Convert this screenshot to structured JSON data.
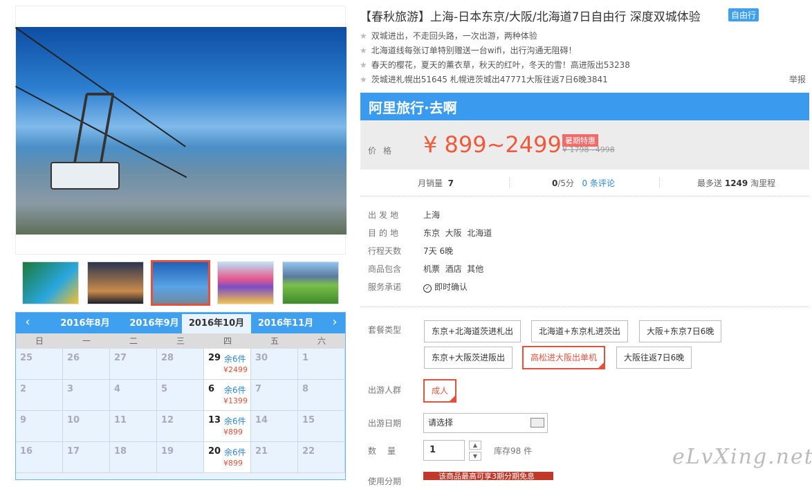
{
  "product": {
    "brand_tag": "【春秋旅游】",
    "title": "上海-日本东京/大阪/北海道7日自由行 深度双城体验",
    "self_tag": "自由行",
    "features": [
      "双城进出，不走回头路，一次出游，两种体验",
      "北海道线每张订单特别赠送一台wifi，出行沟通无阻碍！",
      "春天的樱花，夏天的薰衣草，秋天的红叶，冬天的雪！高进阪出53238",
      "茨城进札幌出51645 札幌进茨城出47771大阪往返7日6晚3841"
    ],
    "report_label": "举报"
  },
  "banner": {
    "logo": "阿里旅行·去啊"
  },
  "price": {
    "label": "价格",
    "value": "¥ 899~2499",
    "promo": "暑期特惠",
    "original": "¥ 1798~4998"
  },
  "stats": {
    "monthly_sales_label": "月销量",
    "monthly_sales": "7",
    "score": "0",
    "score_suffix": "/5分",
    "reviews": "0 条评论",
    "points_prefix": "最多送",
    "points": "1249",
    "points_suffix": "淘里程"
  },
  "info": [
    {
      "label": "出发地",
      "value": "上海"
    },
    {
      "label": "目的地",
      "value": "东京  大阪  北海道"
    },
    {
      "label": "行程天数",
      "value": "7天 6晚"
    },
    {
      "label": "商品包含",
      "value": "机票  酒店  其他"
    },
    {
      "label": "服务承诺",
      "value": "即时确认"
    }
  ],
  "options": {
    "package_label": "套餐类型",
    "packages": [
      "东京+北海道茨进札出",
      "北海道+东京札进茨出",
      "大阪+东京7日6晚",
      "东京+大阪茨进阪出",
      "高松进大阪出单机",
      "大阪往返7日6晚"
    ],
    "selected_package": "高松进大阪出单机",
    "crowd_label": "出游人群",
    "crowd": "成人",
    "date_label": "出游日期",
    "date_placeholder": "请选择",
    "qty_label": "数量",
    "qty": "1",
    "stock": "库存98 件",
    "installment_label": "使用分期",
    "installment_text": "该商品最高可享3期分期免息"
  },
  "calendar": {
    "months": [
      "2016年8月",
      "2016年9月",
      "2016年10月",
      "2016年11月"
    ],
    "active_month": "2016年10月",
    "weekdays": [
      "日",
      "一",
      "二",
      "三",
      "四",
      "五",
      "六"
    ],
    "rows": [
      [
        {
          "d": "25"
        },
        {
          "d": "26"
        },
        {
          "d": "27"
        },
        {
          "d": "28"
        },
        {
          "d": "29",
          "rem": "余6件",
          "price": "¥2499"
        },
        {
          "d": "30"
        },
        {
          "d": "1"
        }
      ],
      [
        {
          "d": "2"
        },
        {
          "d": "3"
        },
        {
          "d": "4"
        },
        {
          "d": "5"
        },
        {
          "d": "6",
          "rem": "余6件",
          "price": "¥1399"
        },
        {
          "d": "7"
        },
        {
          "d": "8"
        }
      ],
      [
        {
          "d": "9"
        },
        {
          "d": "10"
        },
        {
          "d": "11"
        },
        {
          "d": "12"
        },
        {
          "d": "13",
          "rem": "余6件",
          "price": "¥899"
        },
        {
          "d": "14"
        },
        {
          "d": "15"
        }
      ],
      [
        {
          "d": "16"
        },
        {
          "d": "17"
        },
        {
          "d": "18"
        },
        {
          "d": "19"
        },
        {
          "d": "20",
          "rem": "余6件",
          "price": "¥899"
        },
        {
          "d": "21"
        },
        {
          "d": "22"
        }
      ]
    ]
  },
  "watermark": "eLvXing.net"
}
